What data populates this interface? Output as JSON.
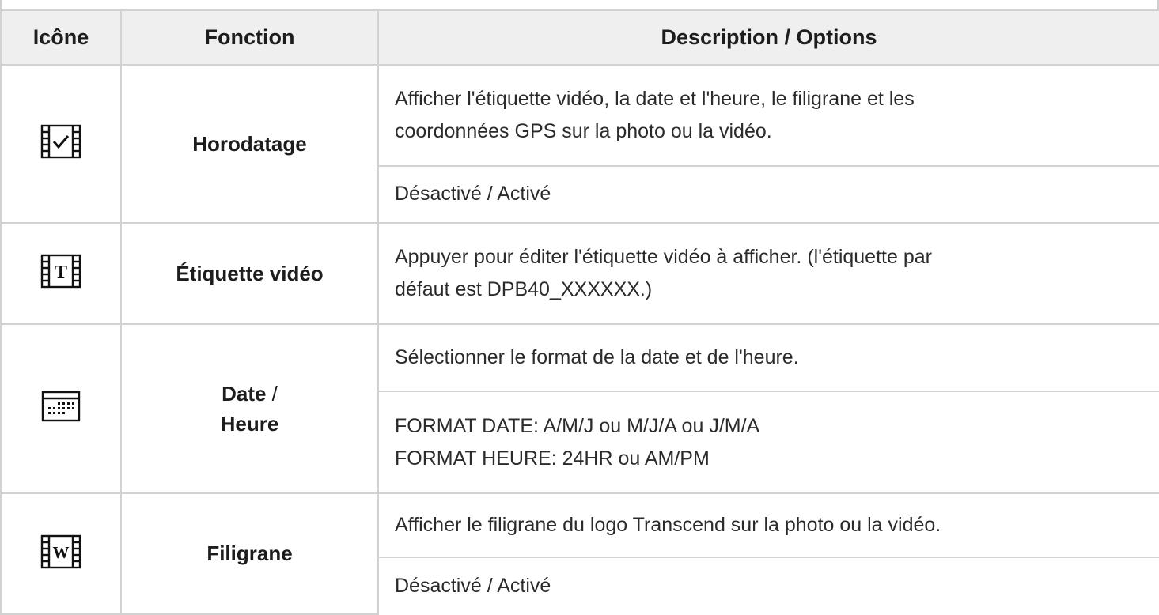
{
  "header": {
    "icon": "Icône",
    "function": "Fonction",
    "description": "Description / Options"
  },
  "rows": [
    {
      "icon": "film-check-icon",
      "function": "Horodatage",
      "description": [
        "Afficher l'étiquette vidéo, la date et l'heure, le filigrane et les",
        "coordonnées GPS sur la photo ou la vidéo."
      ],
      "options": "Désactivé / Activé"
    },
    {
      "icon": "film-text-icon",
      "function": "Étiquette vidéo",
      "description": [
        "Appuyer pour éditer l'étiquette vidéo à afficher. (l'étiquette par",
        "défaut est DPB40_XXXXXX.)"
      ]
    },
    {
      "icon": "calendar-icon",
      "function_line1": "Date",
      "function_sep": " /",
      "function_line2": "Heure",
      "description": "Sélectionner le format de la date et de l'heure.",
      "options": [
        "FORMAT DATE: A/M/J ou M/J/A ou J/M/A",
        "FORMAT HEURE: 24HR ou AM/PM"
      ]
    },
    {
      "icon": "film-watermark-icon",
      "function": "Filigrane",
      "description": "Afficher le filigrane du logo Transcend sur la photo ou la vidéo.",
      "options": "Désactivé / Activé"
    }
  ]
}
